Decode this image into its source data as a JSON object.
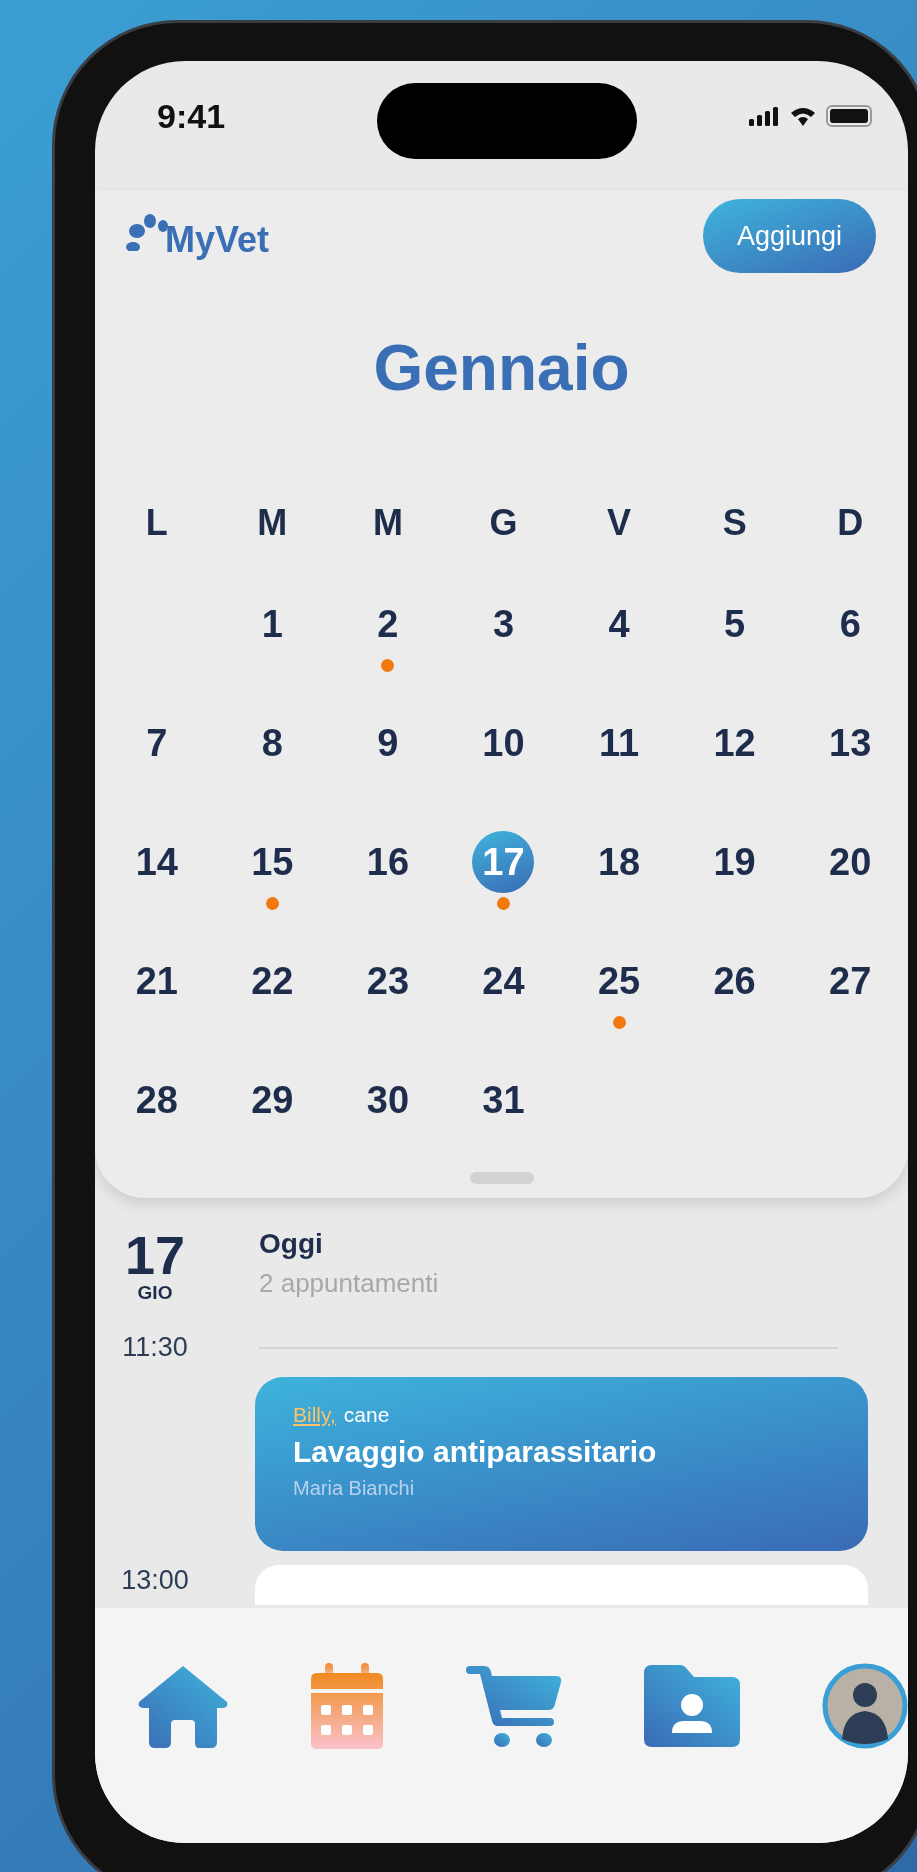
{
  "status_bar": {
    "time": "9:41"
  },
  "header": {
    "logo": "MyVet",
    "add_button": "Aggiungi"
  },
  "calendar": {
    "month": "Gennaio",
    "weekdays": [
      "L",
      "M",
      "M",
      "G",
      "V",
      "S",
      "D"
    ],
    "weeks": [
      [
        {
          "label": "1",
          "selected": false,
          "has_event": false
        },
        {
          "label": "2",
          "selected": false,
          "has_event": true
        },
        {
          "label": "3",
          "selected": false,
          "has_event": false
        },
        {
          "label": "4",
          "selected": false,
          "has_event": false
        },
        {
          "label": "5",
          "selected": false,
          "has_event": false
        },
        {
          "label": "6",
          "selected": false,
          "has_event": false
        }
      ],
      [
        {
          "label": "7",
          "selected": false,
          "has_event": false
        },
        {
          "label": "8",
          "selected": false,
          "has_event": false
        },
        {
          "label": "9",
          "selected": false,
          "has_event": false
        },
        {
          "label": "10",
          "selected": false,
          "has_event": false
        },
        {
          "label": "11",
          "selected": false,
          "has_event": false
        },
        {
          "label": "12",
          "selected": false,
          "has_event": false
        },
        {
          "label": "13",
          "selected": false,
          "has_event": false
        }
      ],
      [
        {
          "label": "14",
          "selected": false,
          "has_event": false
        },
        {
          "label": "15",
          "selected": false,
          "has_event": true
        },
        {
          "label": "16",
          "selected": false,
          "has_event": false
        },
        {
          "label": "17",
          "selected": true,
          "has_event": true
        },
        {
          "label": "18",
          "selected": false,
          "has_event": false
        },
        {
          "label": "19",
          "selected": false,
          "has_event": false
        },
        {
          "label": "20",
          "selected": false,
          "has_event": false
        }
      ],
      [
        {
          "label": "21",
          "selected": false,
          "has_event": false
        },
        {
          "label": "22",
          "selected": false,
          "has_event": false
        },
        {
          "label": "23",
          "selected": false,
          "has_event": false
        },
        {
          "label": "24",
          "selected": false,
          "has_event": false
        },
        {
          "label": "25",
          "selected": false,
          "has_event": true
        },
        {
          "label": "26",
          "selected": false,
          "has_event": false
        },
        {
          "label": "27",
          "selected": false,
          "has_event": false
        }
      ],
      [
        {
          "label": "28",
          "selected": false,
          "has_event": false
        },
        {
          "label": "29",
          "selected": false,
          "has_event": false
        },
        {
          "label": "30",
          "selected": false,
          "has_event": false
        },
        {
          "label": "31",
          "selected": false,
          "has_event": false
        }
      ]
    ]
  },
  "agenda": {
    "day": "17",
    "weekday": "GIO",
    "title": "Oggi",
    "subtitle": "2 appuntamenti",
    "slots": [
      {
        "time": "11:30",
        "appointment": {
          "pet": "Billy,",
          "species": "cane",
          "title": "Lavaggio antiparassitario",
          "doctor": "Maria Bianchi"
        }
      },
      {
        "time": "13:00"
      }
    ]
  },
  "nav": [
    {
      "kind": "home",
      "selected": false
    },
    {
      "kind": "calendar",
      "selected": true
    },
    {
      "kind": "cart",
      "selected": false
    },
    {
      "kind": "folder",
      "selected": false
    },
    {
      "kind": "avatar",
      "selected": false
    }
  ]
}
